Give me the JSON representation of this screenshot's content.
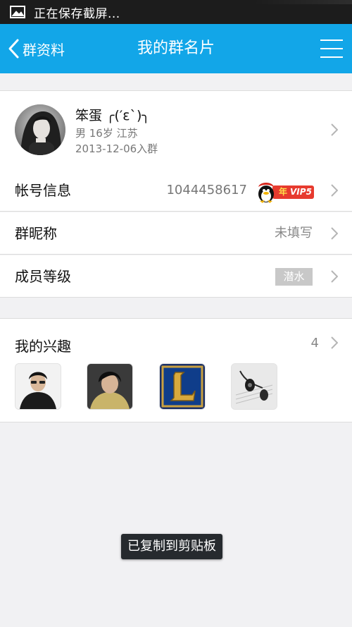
{
  "status_bar": {
    "text": "正在保存截屏...",
    "icon": "image-icon"
  },
  "header": {
    "back_label": "群资料",
    "title": "我的群名片",
    "menu_icon": "menu-icon",
    "color": "#12a6e8"
  },
  "profile": {
    "name": "笨蛋 ╭(′ε`)╮",
    "info": "男  16岁  江苏",
    "join": "2013-12-06入群"
  },
  "rows": {
    "account": {
      "label": "帐号信息",
      "value": "1044458617",
      "vip_year": "年",
      "vip_label": "VIP5"
    },
    "nickname": {
      "label": "群昵称",
      "value": "未填写"
    },
    "level": {
      "label": "成员等级",
      "badge": "潜水"
    }
  },
  "interests": {
    "title": "我的兴趣",
    "count": "4",
    "items": [
      "person-photo-1",
      "person-photo-2",
      "game-logo-l",
      "earphones-photo"
    ]
  },
  "toast": {
    "text": "已复制到剪贴板"
  }
}
